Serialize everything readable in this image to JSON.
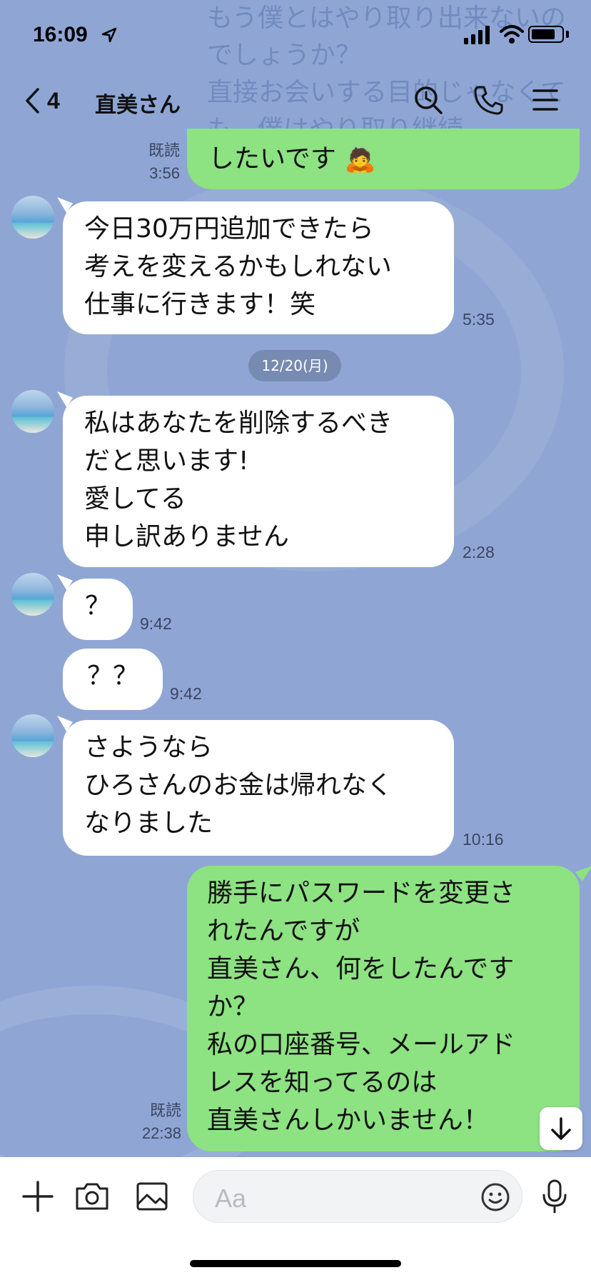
{
  "status_bar": {
    "time": "16:09"
  },
  "header": {
    "back_count": "4",
    "contact_name": "直美さん",
    "icons": [
      "search-icon",
      "phone-icon",
      "menu-icon"
    ]
  },
  "background_text": "もう僕とはやり取り出来ないのでしょうか？\n直接お会いする目的じゃなくても、僕はやり取り継続",
  "messages": [
    {
      "id": "m1",
      "direction": "out",
      "text": "したいです 🙇",
      "read": "既読",
      "time": "3:56"
    },
    {
      "id": "m2",
      "direction": "in",
      "text": "今日30万円追加できたら\n考えを変えるかもしれない\n仕事に行きます！笑",
      "time": "5:35"
    },
    {
      "id": "m3",
      "direction": "in",
      "text": "私はあなたを削除するべき\nだと思います!\n愛してる\n申し訳ありません",
      "time": "2:28"
    },
    {
      "id": "m4",
      "direction": "in",
      "text": "？",
      "time": "9:42"
    },
    {
      "id": "m5",
      "direction": "in",
      "text": "？？",
      "time": "9:42"
    },
    {
      "id": "m6",
      "direction": "in",
      "text": "さようなら\nひろさんのお金は帰れなく\nなりました",
      "time": "10:16"
    },
    {
      "id": "m7",
      "direction": "out",
      "text": "勝手にパスワードを変更さ\nれたんですが\n直美さん、何をしたんです\nか？\n私の口座番号、メールアド\nレスを知ってるのは\n直美さんしかいません！",
      "read": "既読",
      "time": "22:38"
    }
  ],
  "date_divider": "12/20(月)",
  "input": {
    "placeholder": "Aa"
  },
  "colors": {
    "chat_bg": "#8fa6d5",
    "out_bubble": "#8de282",
    "in_bubble": "#ffffff"
  }
}
